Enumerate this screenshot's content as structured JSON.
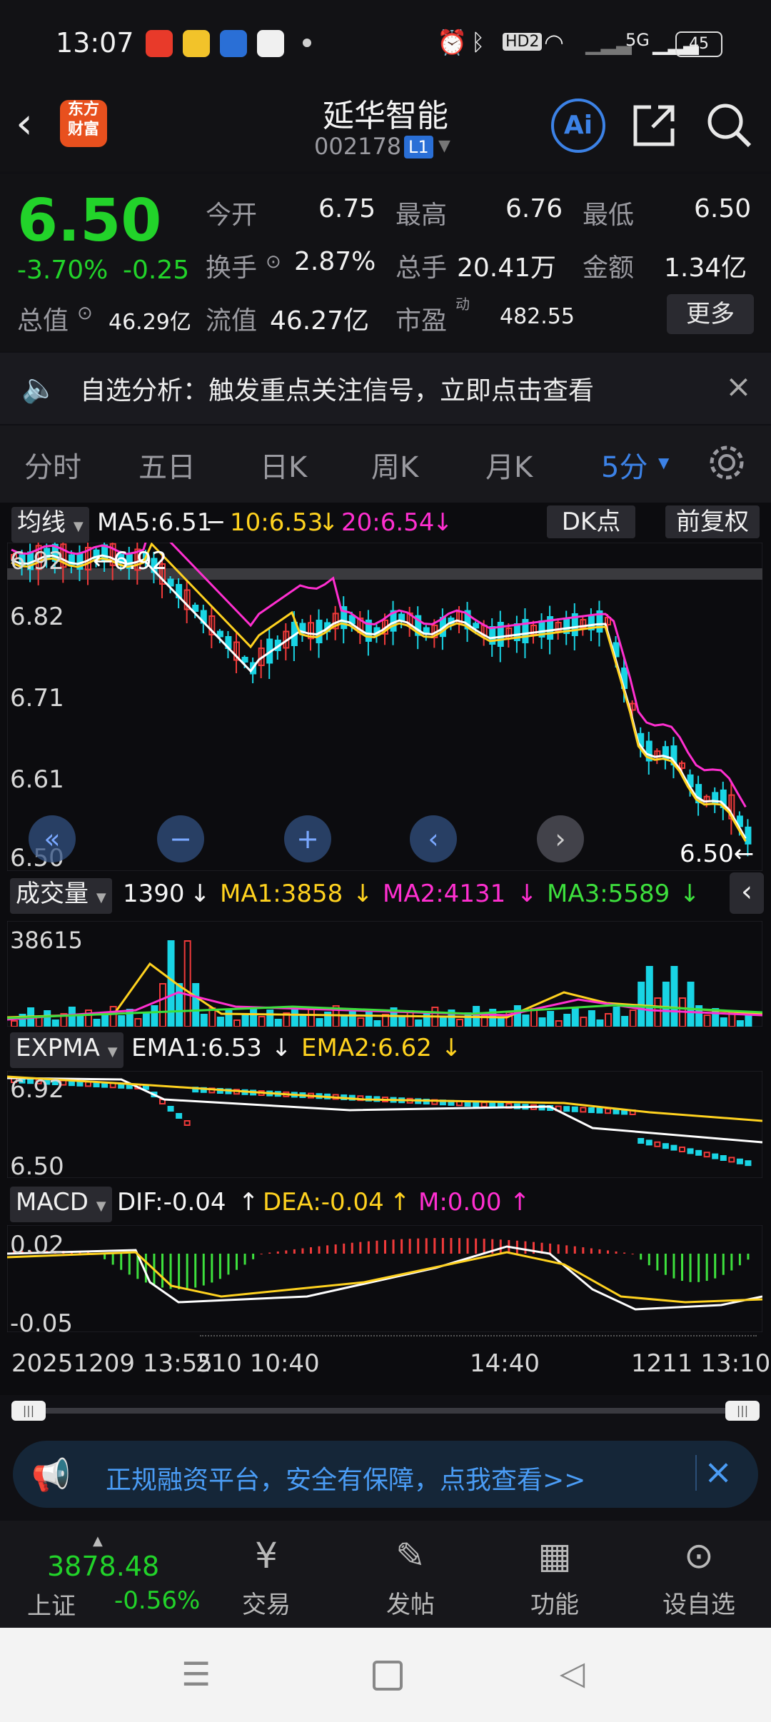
{
  "status_bar": {
    "time": "13:07",
    "battery": "45",
    "network": "5G",
    "hd": "HD2"
  },
  "header": {
    "title": "延华智能",
    "code": "002178",
    "level_badge": "L1",
    "logo_lines": [
      "东方",
      "财富"
    ],
    "ai_label": "Ai"
  },
  "quote": {
    "price": "6.50",
    "change_pct": "-3.70%",
    "change": "-0.25",
    "open_label": "今开",
    "open": "6.75",
    "high_label": "最高",
    "high": "6.76",
    "low_label": "最低",
    "low": "6.50",
    "turnover_label": "换手",
    "turnover": "2.87%",
    "volume_label": "总手",
    "volume": "20.41万",
    "amount_label": "金额",
    "amount": "1.34亿",
    "mktcap_label": "总值",
    "mktcap": "46.29亿",
    "float_label": "流值",
    "float_cap": "46.27亿",
    "pe_label": "市盈",
    "pe_sup": "动",
    "pe": "482.55",
    "more_label": "更多"
  },
  "notice": {
    "text": "自选分析：触发重点关注信号，立即点击查看"
  },
  "tabs": [
    {
      "label": "分时"
    },
    {
      "label": "五日"
    },
    {
      "label": "日K"
    },
    {
      "label": "周K"
    },
    {
      "label": "月K"
    },
    {
      "label": "5分"
    }
  ],
  "ma_row": {
    "name": "均线",
    "ma5": "MA5:6.51",
    "ma10": "10:6.53",
    "ma20": "20:6.54",
    "dk_label": "DK点",
    "adj_label": "前复权"
  },
  "price_axis": [
    "6.92",
    "6.82",
    "6.71",
    "6.61",
    "6.50"
  ],
  "price_marks": {
    "high_tag": "6.92",
    "last_tag": "6.50"
  },
  "vol_row": {
    "name": "成交量",
    "vol": "1390",
    "ma1": "MA1:3858",
    "ma2": "MA2:4131",
    "ma3": "MA3:5589",
    "max": "38615"
  },
  "expma_row": {
    "name": "EXPMA",
    "ema1": "EMA1:6.53",
    "ema2": "EMA2:6.62",
    "top": "6.92",
    "bottom": "6.50"
  },
  "macd_row": {
    "name": "MACD",
    "dif": "DIF:-0.04",
    "dea": "DEA:-0.04",
    "m": "M:0.00",
    "top": "0.02",
    "bottom": "-0.05"
  },
  "time_axis": [
    "20251209 13:55",
    "210 10:40",
    "14:40",
    "1211 13:10"
  ],
  "ad": {
    "text": "正规融资平台，安全有保障，点我查看>>"
  },
  "bottom_nav": {
    "index_value": "3878.48",
    "index_name": "上证",
    "index_change": "-0.56%",
    "items": [
      {
        "label": "交易"
      },
      {
        "label": "发帖"
      },
      {
        "label": "功能"
      },
      {
        "label": "设自选"
      }
    ]
  },
  "colors": {
    "up": "#f03a3a",
    "down": "#22d32a",
    "cyan": "#19d4e4",
    "accent": "#3c82e6"
  }
}
